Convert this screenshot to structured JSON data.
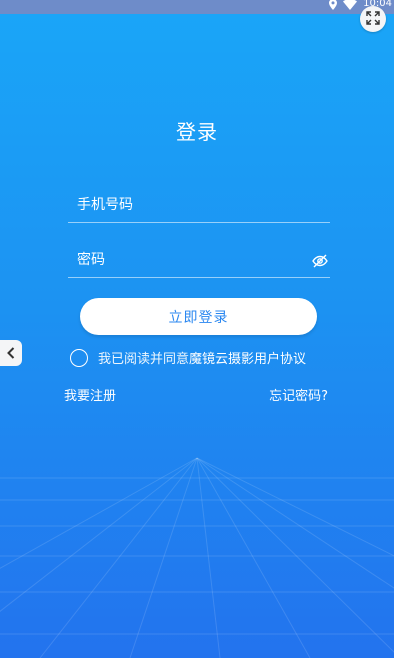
{
  "status_bar": {
    "time": "10:04"
  },
  "title": "登录",
  "phone_field": {
    "placeholder": "手机号码",
    "value": ""
  },
  "password_field": {
    "placeholder": "密码",
    "value": ""
  },
  "login_button": "立即登录",
  "agreement": {
    "text": "我已阅读并同意",
    "link": "魔镜云摄影用户协议",
    "checked": false
  },
  "register_link": "我要注册",
  "forgot_link": "忘记密码?",
  "colors": {
    "background_top": "#1aa6f8",
    "background_bottom": "#2373ee",
    "button_text": "#2a87f0"
  }
}
